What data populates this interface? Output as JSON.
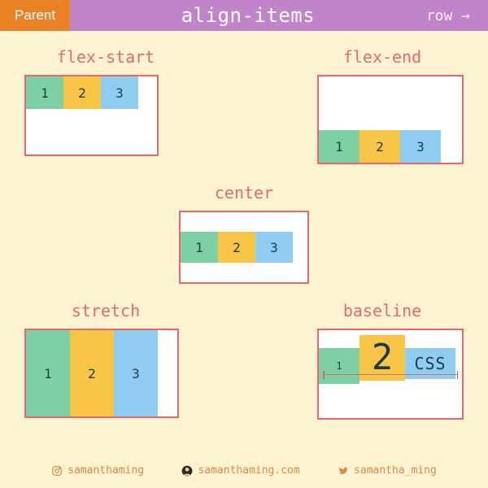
{
  "header": {
    "badge": "Parent",
    "title": "align-items",
    "direction": "row →"
  },
  "demos": {
    "flex_start": {
      "label": "flex-start",
      "items": [
        "1",
        "2",
        "3"
      ]
    },
    "flex_end": {
      "label": "flex-end",
      "items": [
        "1",
        "2",
        "3"
      ]
    },
    "center": {
      "label": "center",
      "items": [
        "1",
        "2",
        "3"
      ]
    },
    "stretch": {
      "label": "stretch",
      "items": [
        "1",
        "2",
        "3"
      ]
    },
    "baseline": {
      "label": "baseline",
      "items": [
        "1",
        "2",
        "CSS"
      ]
    }
  },
  "footer": {
    "instagram": "samanthaming",
    "website": "samanthaming.com",
    "twitter": "samantha_ming"
  },
  "colors": {
    "bg": "#fdf3d1",
    "badge": "#e98127",
    "bar": "#c084c8",
    "border": "#e26a6a",
    "item1": "#7ecfa3",
    "item2": "#f7c646",
    "item3": "#8fcdf0",
    "footer": "#d88a45"
  }
}
